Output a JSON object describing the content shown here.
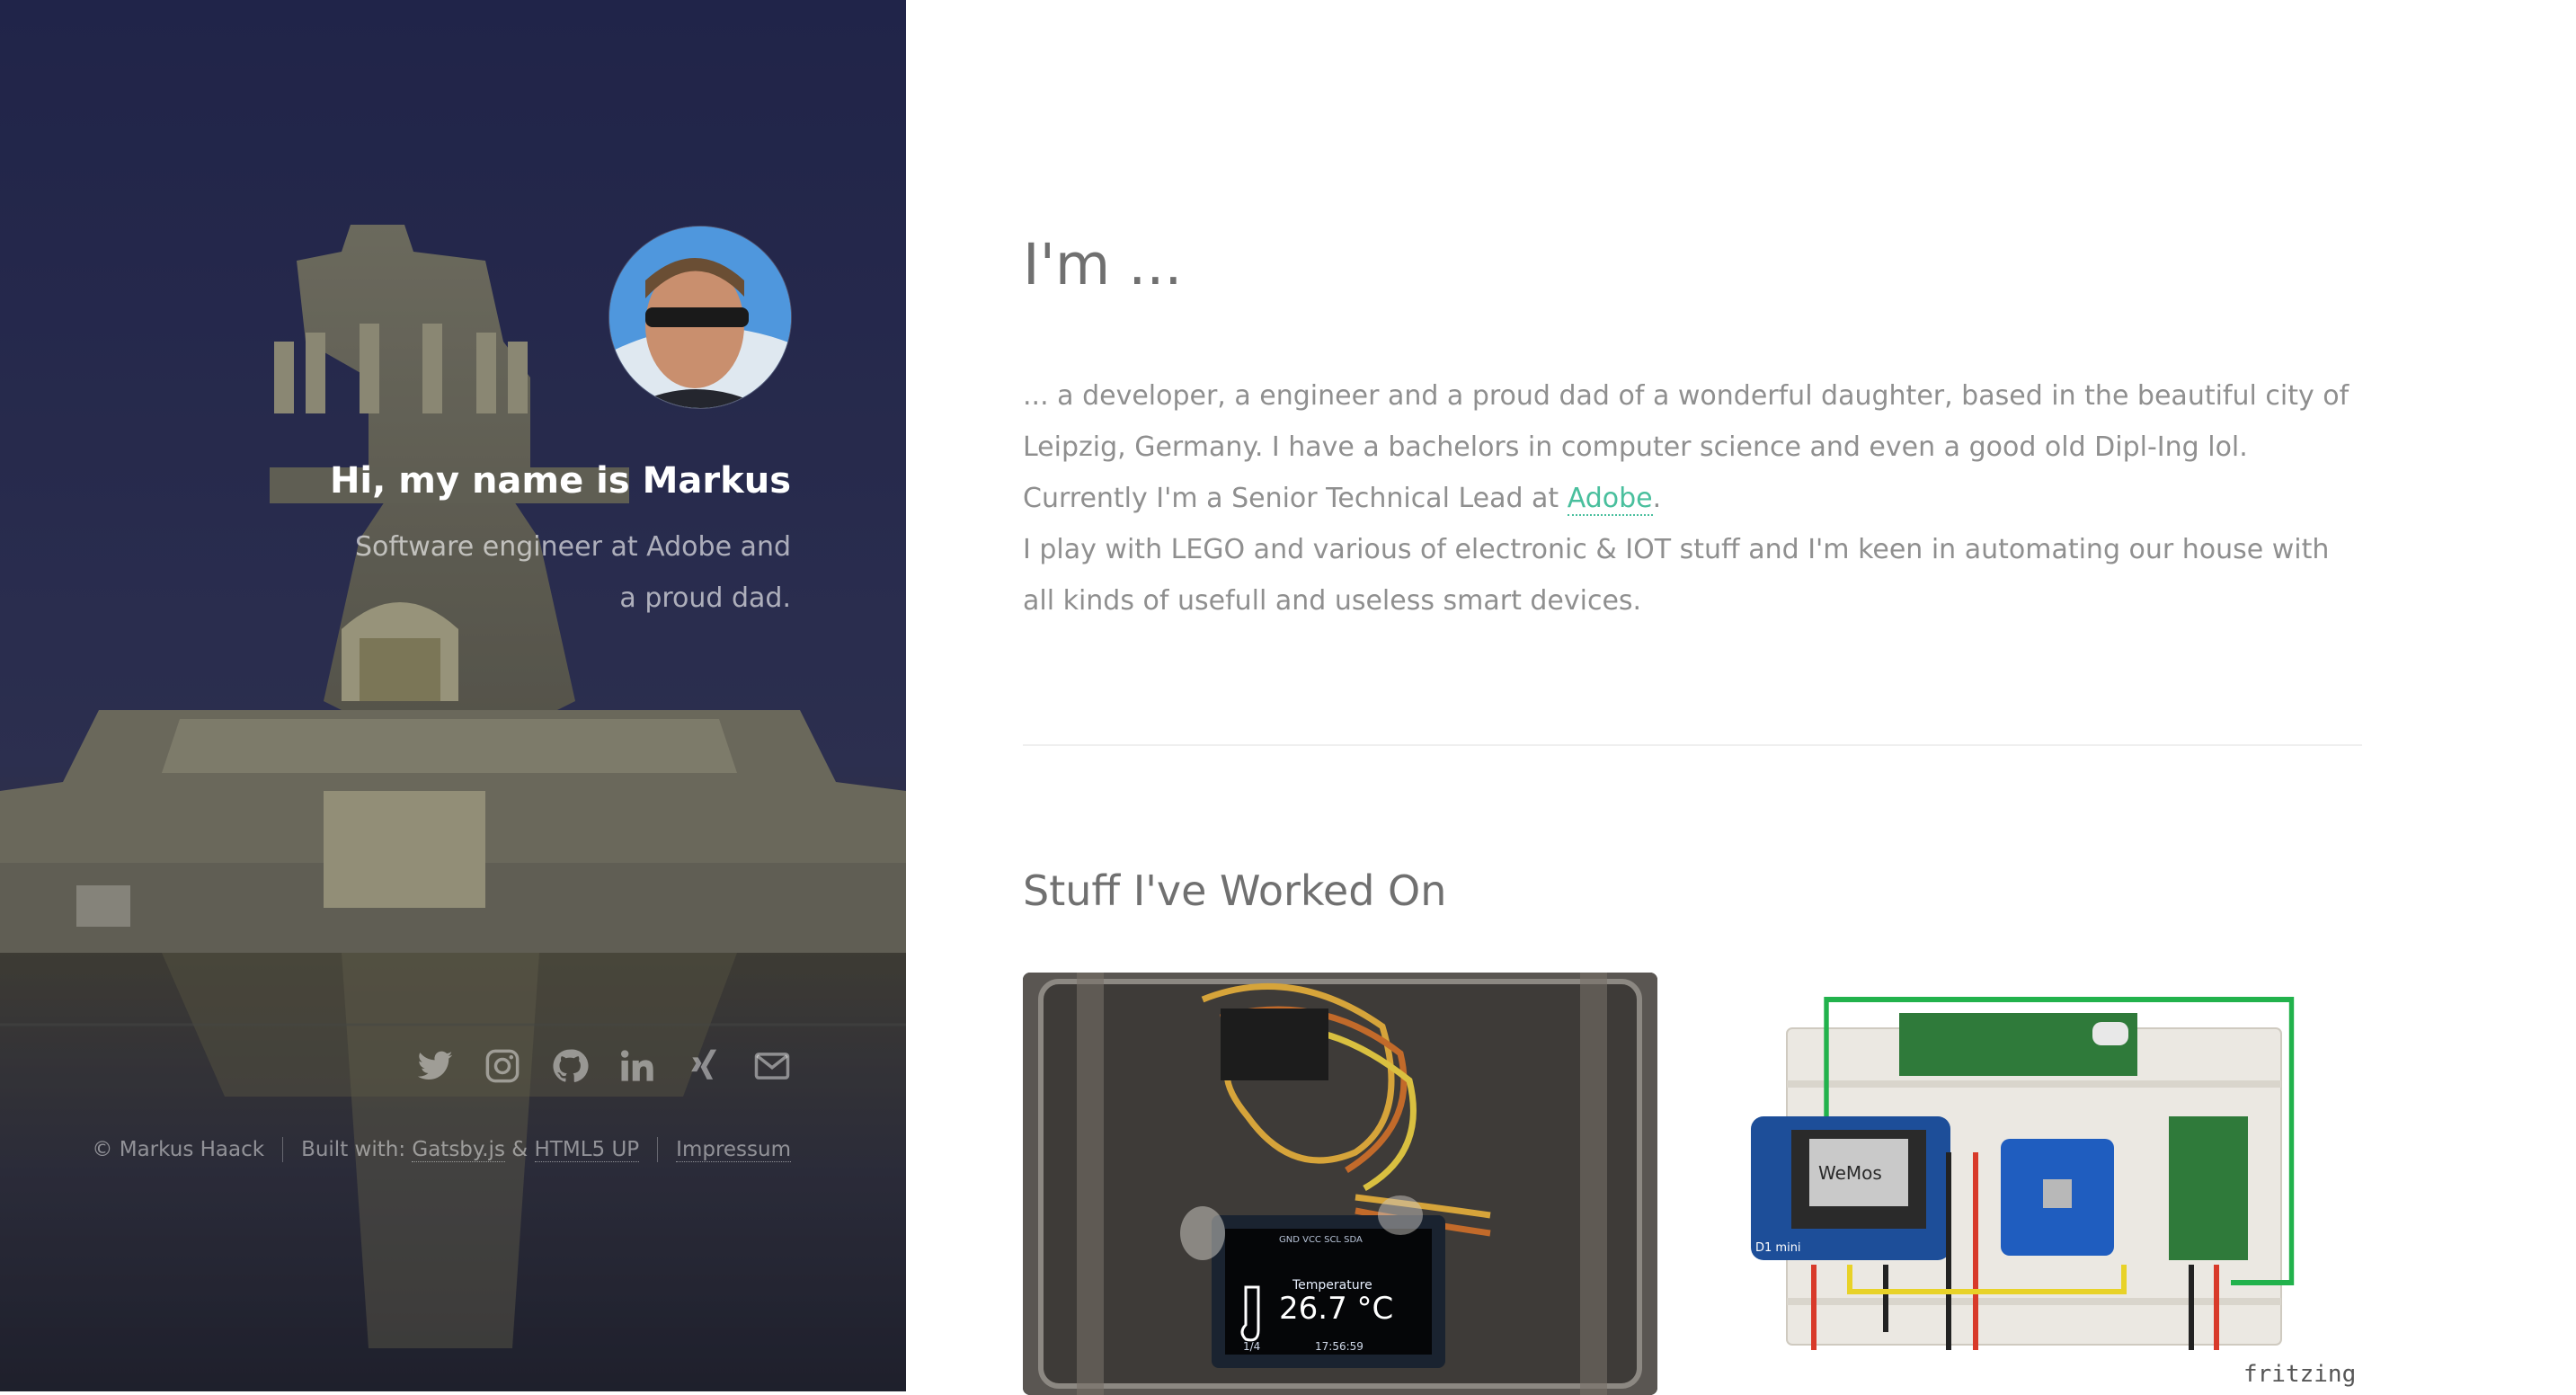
{
  "header": {
    "greeting": "Hi, my name is Markus",
    "tagline": "Software engineer at Adobe and a proud dad.",
    "avatar_icon": "avatar-photo",
    "social": [
      {
        "name": "twitter-icon"
      },
      {
        "name": "instagram-icon"
      },
      {
        "name": "github-icon"
      },
      {
        "name": "linkedin-icon"
      },
      {
        "name": "xing-icon"
      },
      {
        "name": "email-icon"
      }
    ],
    "footer": {
      "copyright": "© Markus Haack",
      "built_with_prefix": "Built with: ",
      "gatsby": "Gatsby.js",
      "amp": " & ",
      "html5up": "HTML5 UP",
      "impressum": "Impressum"
    }
  },
  "about": {
    "title": "I'm ...",
    "paragraph1_before": "... a developer, a engineer and a proud dad of a wonderful daughter, based in the beautiful city of Leipzig, Germany. I have a bachelors in computer science and even a good old Dipl-Ing lol. Currently I'm a Senior Technical Lead at ",
    "adobe_link": "Adobe",
    "paragraph1_after": ".",
    "paragraph2": "I play with LEGO and various of electronic & IOT stuff and I'm keen in automating our house with all kinds of usefull and useless smart devices."
  },
  "work": {
    "title": "Stuff I've Worked On",
    "project1_screen_label": "Temperature",
    "project1_value": "26.7 °C",
    "project1_pins": "GND VCC SCL SDA",
    "project1_page": "1/4",
    "project1_time": "17:56:59",
    "project2_label": "fritzing",
    "project2_board": "D1 mini",
    "project2_brand": "WeMos"
  },
  "colors": {
    "accent": "#49bf9d",
    "heading": "#707070",
    "body_text": "#8f8f8f"
  }
}
